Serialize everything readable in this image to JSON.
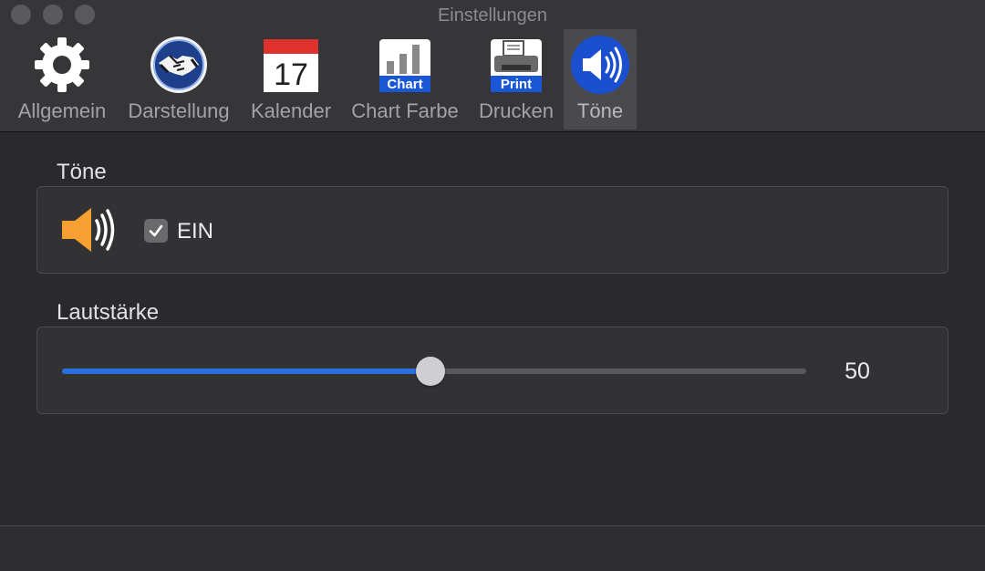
{
  "window": {
    "title": "Einstellungen"
  },
  "toolbar": {
    "items": [
      {
        "label": "Allgemein",
        "icon": "gear-icon"
      },
      {
        "label": "Darstellung",
        "icon": "handshake-icon"
      },
      {
        "label": "Kalender",
        "icon": "calendar-icon",
        "calendar_day": "17"
      },
      {
        "label": "Chart Farbe",
        "icon": "chart-icon",
        "badge": "Chart"
      },
      {
        "label": "Drucken",
        "icon": "printer-icon",
        "badge": "Print"
      },
      {
        "label": "Töne",
        "icon": "speaker-icon",
        "selected": true
      }
    ]
  },
  "sounds": {
    "title": "Töne",
    "checkbox_label": "EIN",
    "checked": true
  },
  "volume": {
    "title": "Lautstärke",
    "value": "50",
    "fraction": 0.5
  },
  "colors": {
    "accent": "#2a6fe0",
    "speaker_orange": "#f5a030",
    "selected_icon_bg": "#1a4fd0"
  }
}
